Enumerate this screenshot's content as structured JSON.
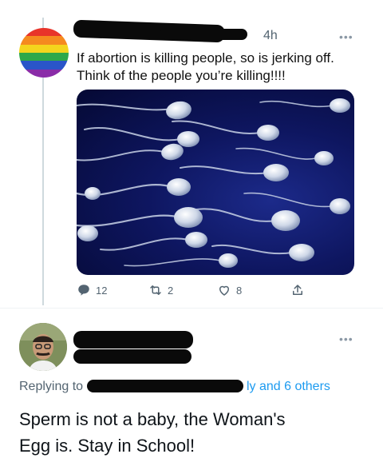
{
  "tweet1": {
    "time": "4h",
    "text_line1": "If abortion is killing people, so is jerking off.",
    "text_line2": "Think of the people you’re killing!!!!",
    "avatar_colors": [
      "#e8342a",
      "#f58a1f",
      "#f4d51d",
      "#2ea84a",
      "#2a55c9",
      "#8a2ca8"
    ],
    "actions": {
      "replies": "12",
      "retweets": "2",
      "likes": "8"
    }
  },
  "tweet2": {
    "replying_prefix": "Replying to",
    "replying_suffix": "ly and 6 others",
    "text_line1": "Sperm is not a baby,  the Woman's",
    "text_line2": "Egg is. Stay in School!"
  },
  "colors": {
    "link": "#1d9bf0",
    "secondary": "#536471"
  },
  "icons": [
    "reply-icon",
    "retweet-icon",
    "like-icon",
    "share-icon",
    "more-icon"
  ]
}
